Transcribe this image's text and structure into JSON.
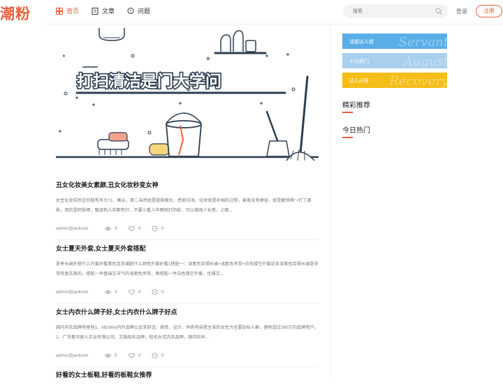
{
  "brand": {
    "logo_text": "潮粉",
    "accent_color": "#e8603c"
  },
  "nav": [
    {
      "label": "首页",
      "icon": "grid-icon",
      "active": true
    },
    {
      "label": "文章",
      "icon": "document-icon",
      "active": false
    },
    {
      "label": "问题",
      "icon": "chat-bubble-icon",
      "active": false
    }
  ],
  "search": {
    "placeholder": "搜索",
    "icon": "search-icon"
  },
  "auth": {
    "login_label": "登录",
    "register_label": "注册"
  },
  "banner": {
    "title": "打扫清洁是门大学问"
  },
  "articles": [
    {
      "title": "丑女化妆美女素颜,丑女化妆秒变女神",
      "excerpt": "女生化妆前后区别能有多大?1、画尖。第二当然就是搓肢眼头，感谢刘海。化妆就是补拙的过程，竟美没有捷径，就是勤快啊～打了鼻影，用的是阿影棒，眼皮和人中都有打，不要小看人中两侧打阴影，可以增强少女感，上眼...",
      "author": "admin@jackson",
      "views": "9",
      "likes": "0",
      "comments": "0"
    },
    {
      "title": "女士夏天外套,女士夏天外套搭配",
      "excerpt": "夏季长裙外搭什么外套好看紫色连衣裙配什么颜色外套好看1搭配一：深紫色百褶长裙+浅紫色吊带+白色镂空外套这条深紫色百褶长裙是非常有复古美的，搭配一件基础又洋气的浅紫色吊带，再搭配一件白色镂空外套，优雅又...",
      "author": "admin@jackson",
      "views": "3",
      "likes": "0",
      "comments": "0"
    },
    {
      "title": "女士内衣什么牌子好,女士内衣什么牌子好点",
      "excerpt": "国内内衣品牌有哪些1、NEIWAI内外品牌以追求舒适，质感，设计，并具有自我主张的女性为主要目标人群，拥有超过300万的品牌用户。2、广东都市丽人实业有限公司，文胸知名品牌，知名女式内衣品牌，国内较早...",
      "author": "admin@jackson",
      "views": "5",
      "likes": "0",
      "comments": "0"
    },
    {
      "title": "好看的女士板鞋,好看的板鞋女推荐"
    }
  ],
  "sidebar": {
    "buttons": [
      {
        "label": "话题达人榜",
        "watermark": "Servant",
        "color": "#5aaee8"
      },
      {
        "label": "十月热门",
        "watermark": "August",
        "color": "#a9cfee"
      },
      {
        "label": "达人问答",
        "watermark": "Recovery",
        "color": "#f5bd18"
      }
    ],
    "sections": [
      {
        "title": "精彩推荐"
      },
      {
        "title": "今日热门"
      }
    ]
  }
}
